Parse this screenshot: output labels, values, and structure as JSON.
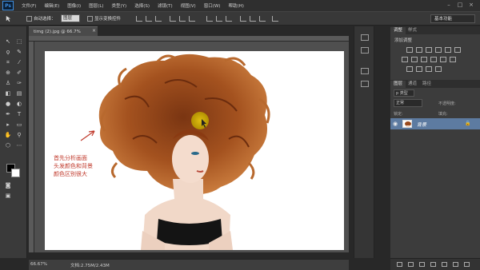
{
  "app": {
    "logo": "Ps"
  },
  "menu": [
    "文件(F)",
    "编辑(E)",
    "图像(I)",
    "图层(L)",
    "类型(Y)",
    "选择(S)",
    "滤镜(T)",
    "视图(V)",
    "窗口(W)",
    "帮助(H)"
  ],
  "options": {
    "auto_select_label": "自动选择：",
    "layer_select_value": "图层",
    "show_transform_label": "显示变换控件",
    "workspace": "基本功能"
  },
  "document": {
    "tab_title": "timg (2).jpg @ 66.7%(RGB/8)",
    "close_glyph": "×",
    "zoom": "66.67%",
    "doc_size": "文档:2.75M/2.43M"
  },
  "annotation": {
    "lines": [
      "首先分析画面",
      "头发颜色和背景",
      "颜色区别很大"
    ],
    "color": "#c0392b"
  },
  "panels": {
    "adjustments_tabs": [
      "调整",
      "样式"
    ],
    "add_adjustment_label": "添加调整",
    "layers_tabs": [
      "图层",
      "通道",
      "路径"
    ],
    "kind_filter": "p 类型",
    "blend_mode": "正常",
    "opacity_label": "不透明度:",
    "lock_label": "锁定:",
    "fill_label": "填充:",
    "layer": {
      "name": "背景",
      "visible_icon": "eye-icon",
      "lock_icon": "lock-icon"
    }
  },
  "colors": {
    "accent": "#3d8de0",
    "selected_layer": "#5d7ba1",
    "hair": "#9a4a1c",
    "cursor_highlight": "#d4b800"
  }
}
